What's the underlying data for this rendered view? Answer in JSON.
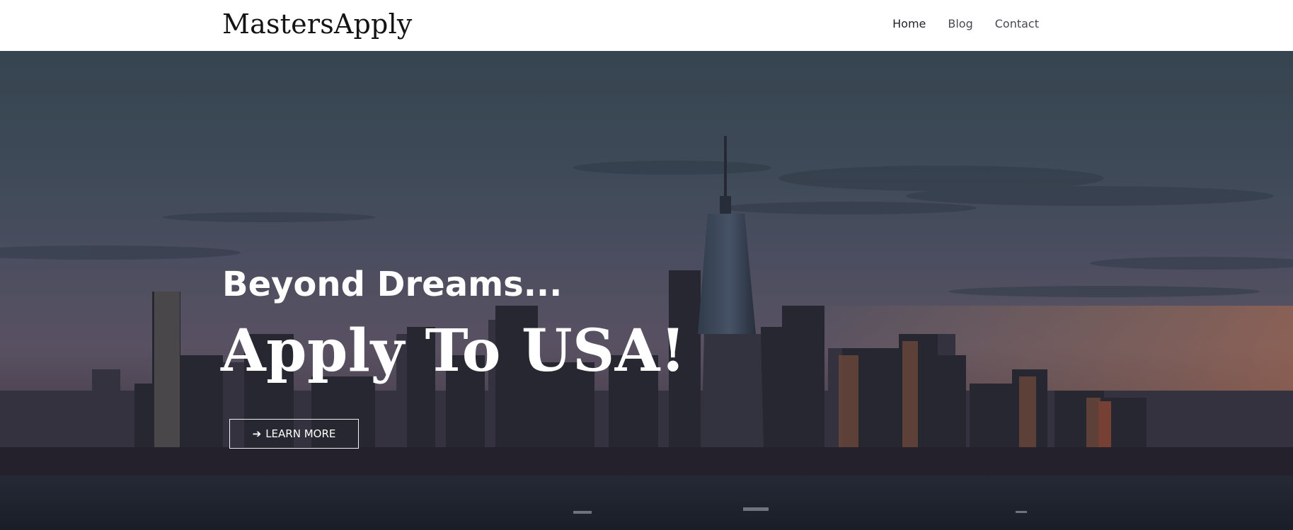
{
  "header": {
    "brand": "MastersApply",
    "nav": [
      {
        "label": "Home"
      },
      {
        "label": "Blog"
      },
      {
        "label": "Contact"
      }
    ]
  },
  "hero": {
    "subtitle": "Beyond Dreams...",
    "title": "Apply To USA!",
    "button": {
      "label": "LEARN MORE",
      "icon": "arrow-right-icon"
    },
    "background": {
      "description_icon": "city-skyline-image"
    }
  },
  "colors": {
    "header_bg": "#ffffff",
    "brand_text": "#141414",
    "nav_text": "#444a4f",
    "hero_text": "#ffffff",
    "sky_top": "#41525e",
    "sky_dusk": "#6d6275"
  }
}
